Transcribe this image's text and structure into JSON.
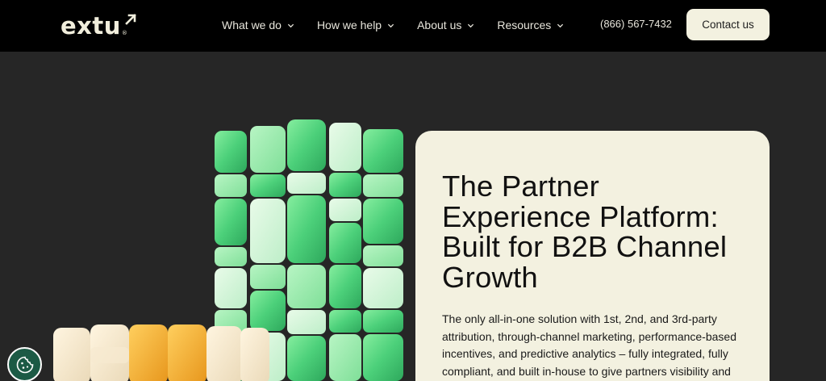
{
  "brand": {
    "logo_text": "extu",
    "registered_mark": "®"
  },
  "nav": {
    "items": [
      {
        "label": "What we do"
      },
      {
        "label": "How we help"
      },
      {
        "label": "About us"
      },
      {
        "label": "Resources"
      }
    ],
    "phone": "(866) 567-7432",
    "contact_label": "Contact us"
  },
  "hero": {
    "title_lines": [
      "The Partner",
      "Experience Platform:",
      "Built for B2B Channel",
      "Growth"
    ],
    "body": "The only all-in-one solution with 1st, 2nd, and 3rd-party attribution, through-channel marketing, performance-based incentives, and predictive analytics – fully integrated, fully compliant, and built in-house to give partners visibility and control of spend and"
  },
  "colors": {
    "nav_bg": "#000000",
    "page_bg": "#262626",
    "card_bg": "#f3f1e0",
    "brand_green": "#4cd07a",
    "accent_orange": "#f0a830",
    "cookie_bg": "#1c5a45"
  },
  "icons": {
    "nav_dropdown": "chevron-down-icon",
    "logo_arrow": "arrow-up-right-icon",
    "cookie": "cookie-icon"
  }
}
